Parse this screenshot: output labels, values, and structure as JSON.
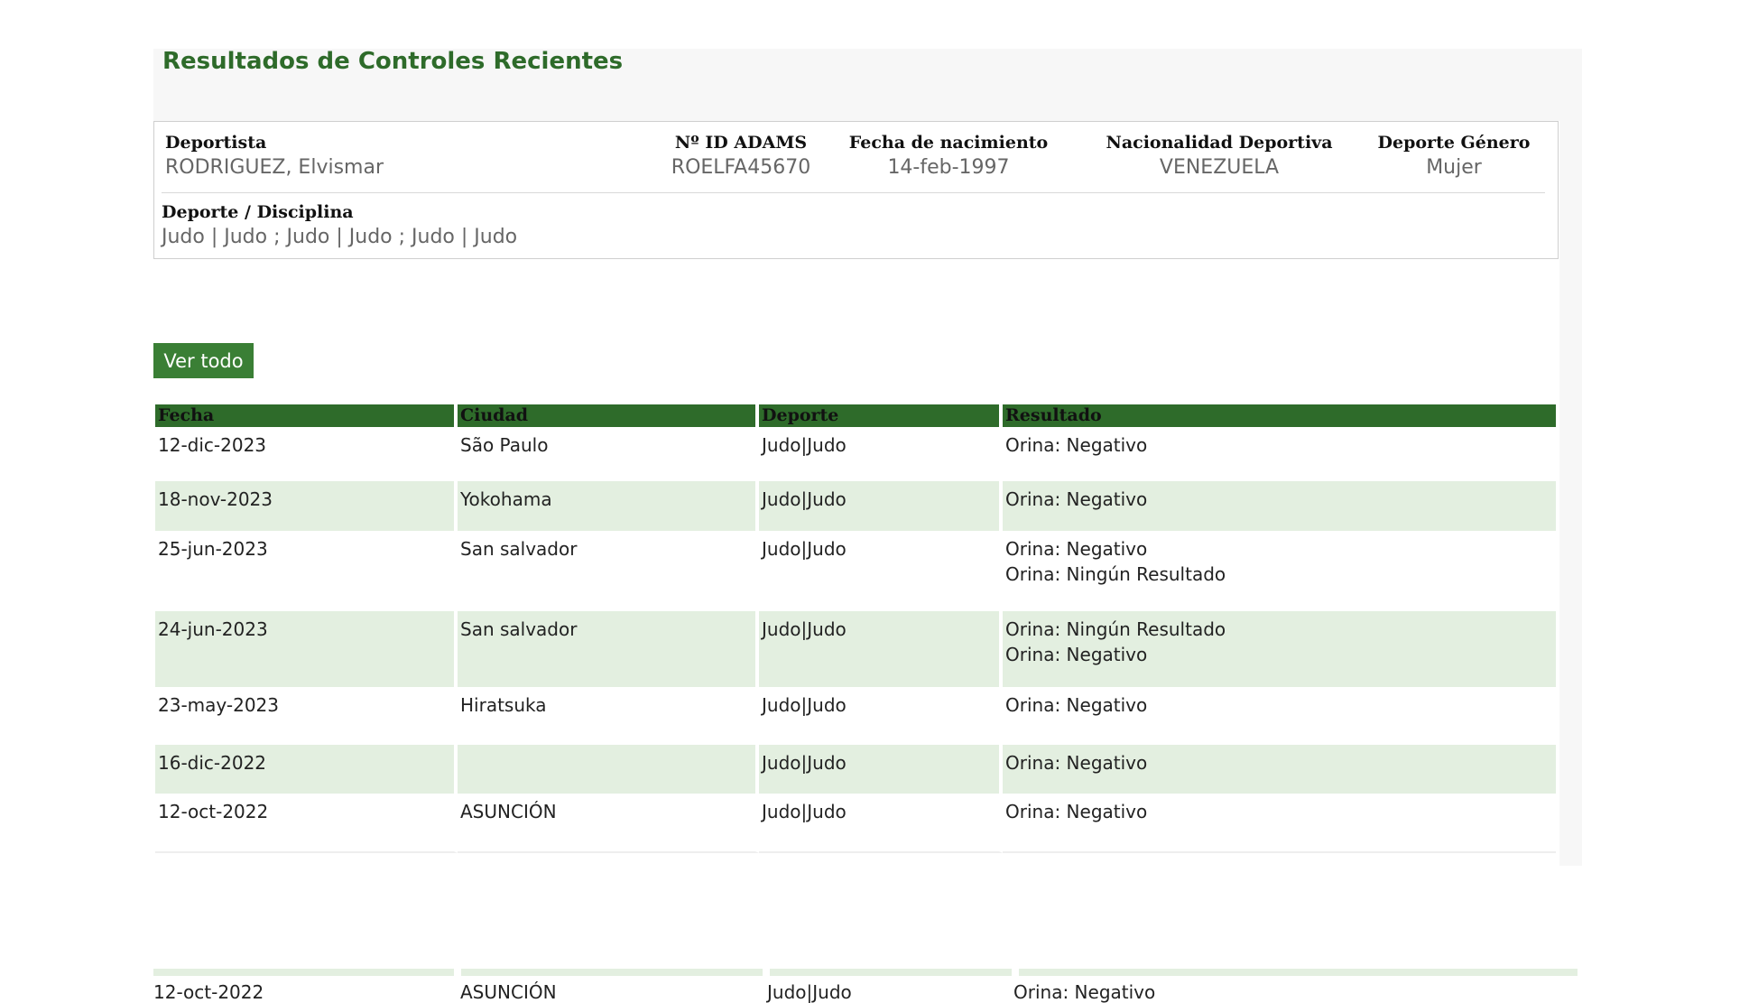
{
  "header": {
    "title": "Resultados de Controles Recientes"
  },
  "athlete": {
    "deportista_label": "Deportista",
    "deportista_value": "RODRIGUEZ, Elvismar",
    "adams_label": "Nº ID ADAMS",
    "adams_value": "ROELFA45670",
    "dob_label": "Fecha de nacimiento",
    "dob_value": "14-feb-1997",
    "nationality_label": "Nacionalidad Deportiva",
    "nationality_value": "VENEZUELA",
    "gender_label": "Deporte Género",
    "gender_value": "Mujer",
    "discipline_label": "Deporte / Disciplina",
    "discipline_value": "Judo | Judo ; Judo | Judo ; Judo | Judo"
  },
  "actions": {
    "view_all_label": "Ver todo"
  },
  "table": {
    "columns": [
      "Fecha",
      "Ciudad",
      "Deporte",
      "Resultado"
    ],
    "rows": [
      {
        "fecha": "12-dic-2023",
        "ciudad": "São Paulo",
        "deporte": "Judo|Judo",
        "resultado": [
          "Orina: Negativo"
        ]
      },
      {
        "fecha": "18-nov-2023",
        "ciudad": "Yokohama",
        "deporte": "Judo|Judo",
        "resultado": [
          "Orina: Negativo"
        ]
      },
      {
        "fecha": "25-jun-2023",
        "ciudad": "San salvador",
        "deporte": "Judo|Judo",
        "resultado": [
          "Orina: Negativo",
          "Orina: Ningún Resultado"
        ]
      },
      {
        "fecha": "24-jun-2023",
        "ciudad": "San salvador",
        "deporte": "Judo|Judo",
        "resultado": [
          "Orina: Ningún Resultado",
          "Orina: Negativo"
        ]
      },
      {
        "fecha": "23-may-2023",
        "ciudad": "Hiratsuka",
        "deporte": "Judo|Judo",
        "resultado": [
          "Orina: Negativo"
        ]
      },
      {
        "fecha": "16-dic-2022",
        "ciudad": "",
        "deporte": "Judo|Judo",
        "resultado": [
          "Orina: Negativo"
        ]
      },
      {
        "fecha": "12-oct-2022",
        "ciudad": "ASUNCIÓN",
        "deporte": "Judo|Judo",
        "resultado": [
          "Orina: Negativo"
        ]
      }
    ]
  },
  "overflow_row": {
    "fecha": "12-oct-2022",
    "ciudad": "ASUNCIÓN",
    "deporte": "Judo|Judo",
    "resultado": "Orina: Negativo"
  },
  "colors": {
    "accent": "#2e6b2a",
    "button": "#3a7f35",
    "alt_row": "#e3efe0"
  }
}
